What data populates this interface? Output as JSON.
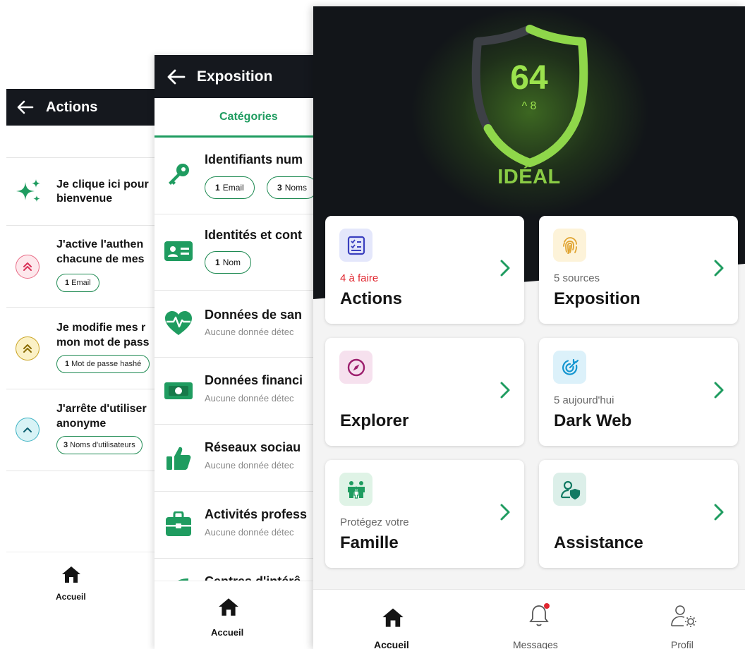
{
  "actions_screen": {
    "title": "Actions",
    "items": [
      {
        "label_line1": "Je clique ici pour",
        "label_line2": "bienvenue",
        "icon": "sparkles-icon"
      },
      {
        "label_line1": "J'active l'authen",
        "label_line2": "chacune de mes",
        "icon": "chevrons-up-icon",
        "chip_count": "1",
        "chip_text": "Email"
      },
      {
        "label_line1": "Je modifie mes r",
        "label_line2": "mon mot de pass",
        "icon": "chevrons-up-icon",
        "chip_count": "1",
        "chip_text": "Mot de passe hashé"
      },
      {
        "label_line1": "J'arrête d'utiliser",
        "label_line2": "anonyme",
        "icon": "chevron-up-icon",
        "chip_count": "3",
        "chip_text": "Noms d'utilisateurs"
      }
    ],
    "nav_home": "Accueil"
  },
  "exposition_screen": {
    "title": "Exposition",
    "tab": "Catégories",
    "categories": [
      {
        "title": "Identifiants num",
        "icon": "key-icon",
        "chips": [
          {
            "count": "1",
            "text": "Email"
          },
          {
            "count": "3",
            "text": "Noms"
          }
        ]
      },
      {
        "title": "Identités et cont",
        "icon": "id-card-icon",
        "chips": [
          {
            "count": "1",
            "text": "Nom"
          }
        ]
      },
      {
        "title": "Données de san",
        "icon": "heartbeat-icon",
        "subtitle": "Aucune donnée détec"
      },
      {
        "title": "Données financi",
        "icon": "banknote-icon",
        "subtitle": "Aucune donnée détec"
      },
      {
        "title": "Réseaux sociau",
        "icon": "thumbs-up-icon",
        "subtitle": "Aucune donnée détec"
      },
      {
        "title": "Activités profess",
        "icon": "briefcase-icon",
        "subtitle": "Aucune donnée détec"
      },
      {
        "title": "Centres d'intérê",
        "icon": "leaf-icon"
      }
    ],
    "nav_home": "Accueil"
  },
  "dashboard_screen": {
    "score": "64",
    "score_delta": "^ 8",
    "score_fraction": 0.64,
    "score_label": "IDÉAL",
    "cards": [
      {
        "title": "Actions",
        "subtitle": "4 à faire",
        "subtitle_color": "#e0262f",
        "icon": "checklist-icon"
      },
      {
        "title": "Exposition",
        "subtitle": "5 sources",
        "icon": "fingerprint-icon"
      },
      {
        "title": "Explorer",
        "subtitle": "",
        "icon": "compass-icon"
      },
      {
        "title": "Dark Web",
        "subtitle": "5 aujourd'hui",
        "icon": "target-icon"
      },
      {
        "title": "Famille",
        "subtitle": "Protégez votre",
        "icon": "family-icon"
      },
      {
        "title": "Assistance",
        "subtitle": "",
        "icon": "user-shield-icon"
      }
    ],
    "nav": {
      "home": "Accueil",
      "messages": "Messages",
      "profile": "Profil"
    },
    "colors": {
      "accent_green": "#1f9c60",
      "score_green": "#9be34d",
      "alert_red": "#e0262f",
      "header_dark": "#15181e"
    }
  }
}
